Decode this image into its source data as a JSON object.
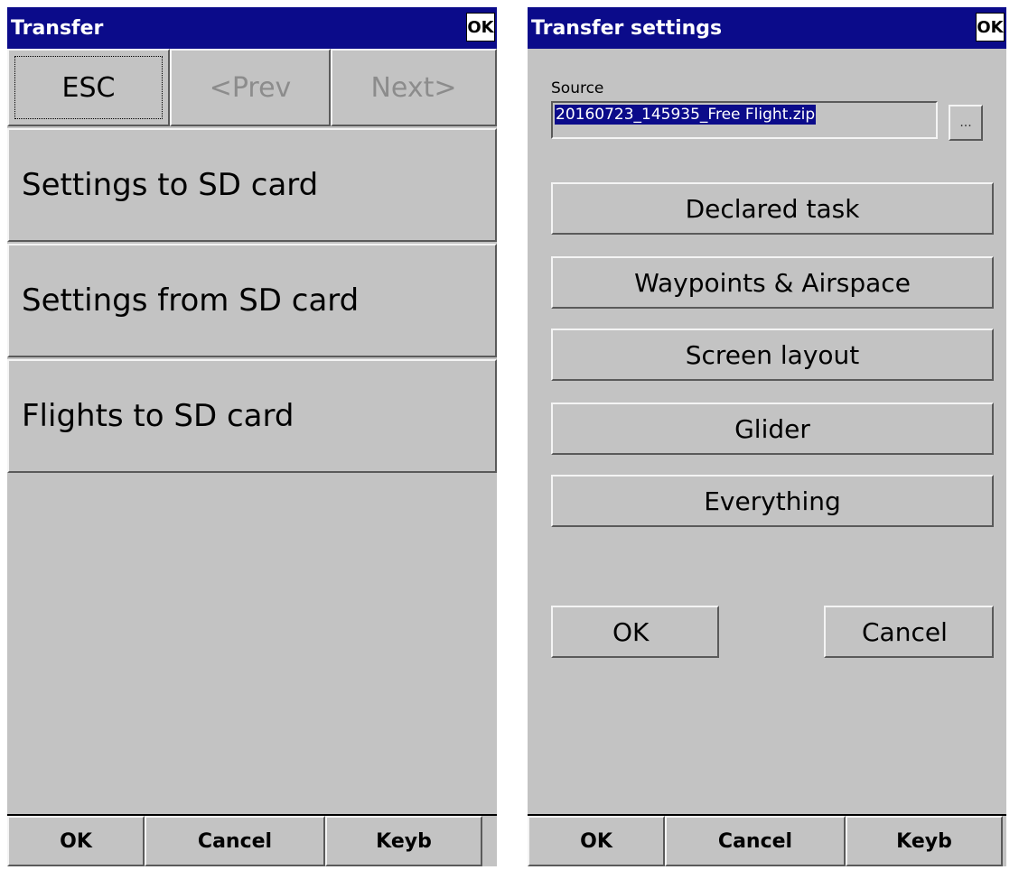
{
  "left_screen": {
    "title": "Transfer",
    "ok_badge": "OK",
    "nav": {
      "esc": "ESC",
      "prev": "<Prev",
      "next": "Next>"
    },
    "items": [
      {
        "label": "Settings to SD card"
      },
      {
        "label": "Settings from SD card"
      },
      {
        "label": "Flights to SD card"
      }
    ],
    "bottom": {
      "ok": "OK",
      "cancel": "Cancel",
      "keyb": "Keyb"
    }
  },
  "right_screen": {
    "title": "Transfer settings",
    "ok_badge": "OK",
    "source": {
      "label": "Source",
      "value": "20160723_145935_Free Flight.zip",
      "browse": "..."
    },
    "options": [
      {
        "label": "Declared task"
      },
      {
        "label": "Waypoints & Airspace"
      },
      {
        "label": "Screen layout"
      },
      {
        "label": "Glider"
      },
      {
        "label": "Everything"
      }
    ],
    "dialog": {
      "ok": "OK",
      "cancel": "Cancel"
    },
    "bottom": {
      "ok": "OK",
      "cancel": "Cancel",
      "keyb": "Keyb"
    }
  },
  "colors": {
    "titlebar": "#0b0b8a",
    "background": "#c3c3c3",
    "disabled_text": "#8c8c8c",
    "selection": "#0b0b8a"
  }
}
